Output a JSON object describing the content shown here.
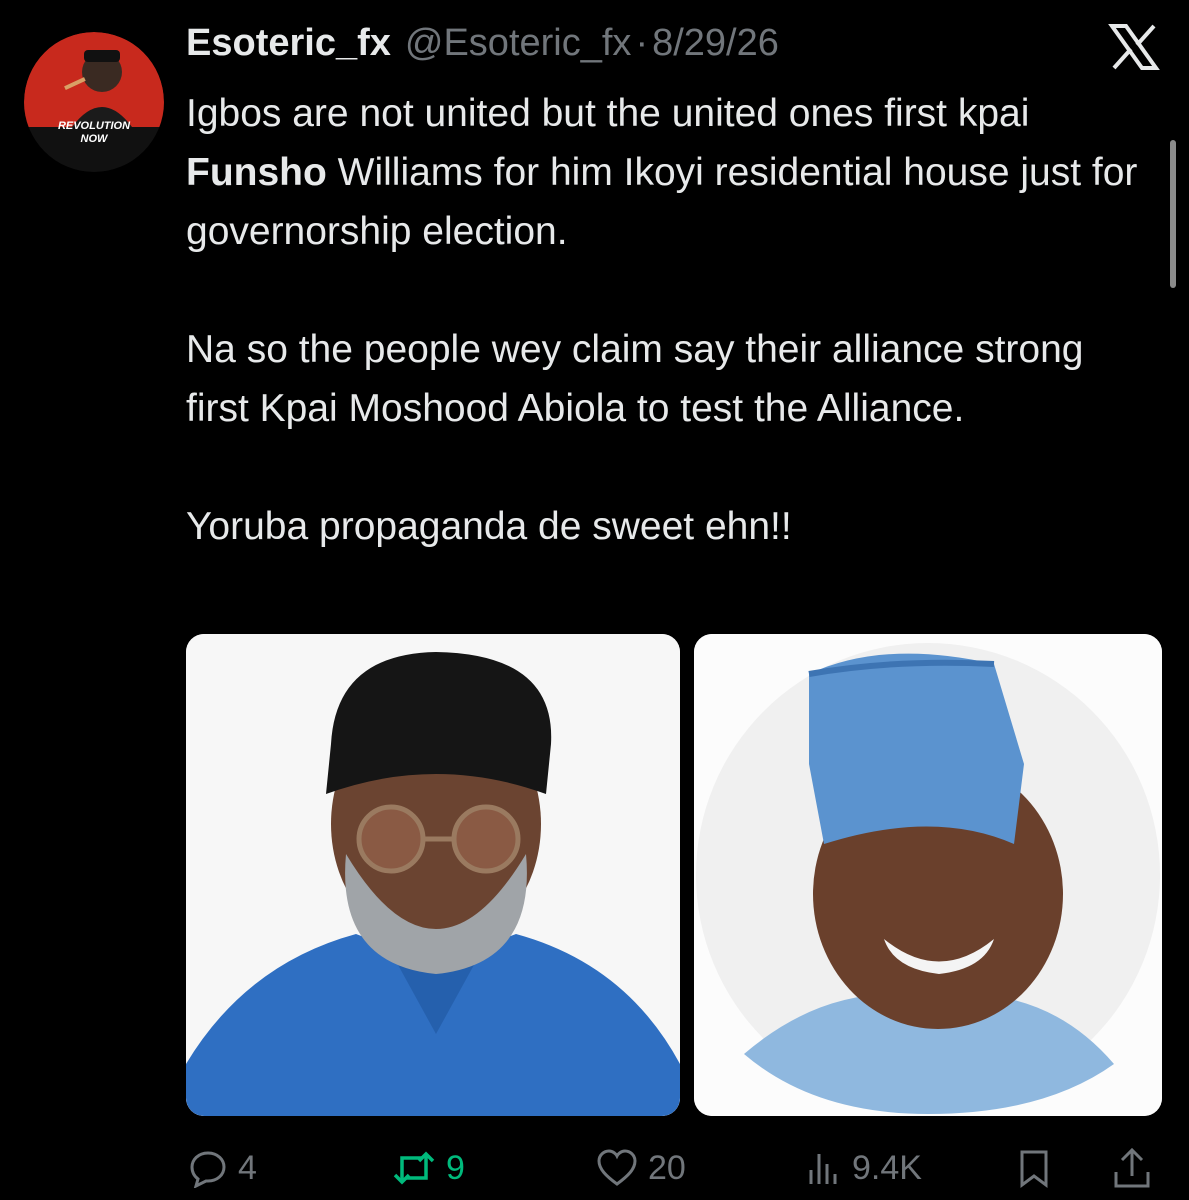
{
  "avatar": {
    "caption_line1": "REVOLUTION",
    "caption_line2": "NOW",
    "accent": "#c8291d"
  },
  "author": {
    "display_name": "Esoteric_fx",
    "handle": "@Esoteric_fx",
    "separator": "·",
    "date": "8/29/26"
  },
  "tweet": {
    "p1_before": "Igbos are not united but the united ones first kpai ",
    "p1_bold": "Funsho",
    "p1_after": " Williams for him Ikoyi residential house just for governorship election.",
    "p2": "Na so the people wey claim say their alliance strong first Kpai Moshood Abiola to test the Alliance.",
    "p3": "Yoruba propaganda de sweet ehn!!"
  },
  "media": [
    {
      "name": "photo-left",
      "subject": "man in black cap and blue shirt"
    },
    {
      "name": "photo-right",
      "subject": "smiling man in blue cap"
    }
  ],
  "actions": {
    "replies": "4",
    "reposts": "9",
    "likes": "20",
    "views": "9.4K"
  },
  "colors": {
    "background": "#000000",
    "text": "#e7e9ea",
    "muted": "#71767b",
    "repost_active": "#00ba7c"
  },
  "icons": [
    "x-logo-icon",
    "reply-icon",
    "repost-icon",
    "like-icon",
    "views-icon",
    "bookmark-icon",
    "share-icon"
  ]
}
